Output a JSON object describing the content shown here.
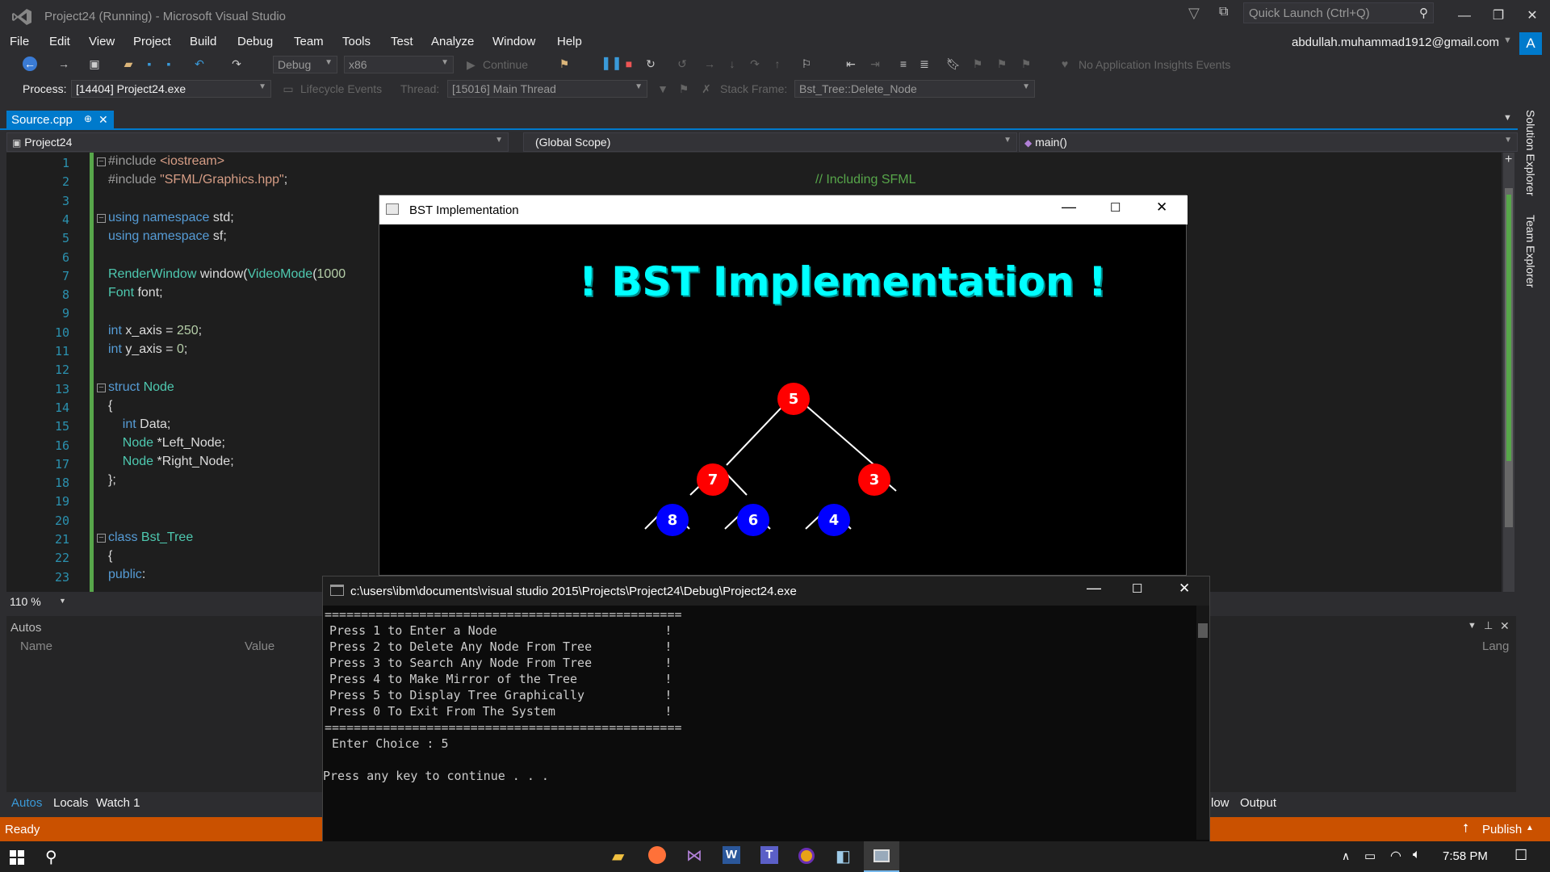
{
  "window": {
    "title": "Project24 (Running) - Microsoft Visual Studio",
    "quick_launch_placeholder": "Quick Launch (Ctrl+Q)",
    "account": "abdullah.muhammad1912@gmail.com",
    "avatar_letter": "A"
  },
  "menu": [
    "File",
    "Edit",
    "View",
    "Project",
    "Build",
    "Debug",
    "Team",
    "Tools",
    "Test",
    "Analyze",
    "Window",
    "Help"
  ],
  "toolbar": {
    "config": "Debug",
    "platform": "x86",
    "continue_label": "Continue",
    "insights": "No Application Insights Events",
    "process_label": "Process:",
    "process_value": "[14404] Project24.exe",
    "lifecycle": "Lifecycle Events",
    "thread_label": "Thread:",
    "thread_value": "[15016] Main Thread",
    "stack_label": "Stack Frame:",
    "stack_value": "Bst_Tree::Delete_Node"
  },
  "editor": {
    "tab": "Source.cpp",
    "project_combo": "Project24",
    "scope_combo": "(Global Scope)",
    "member_combo": "main()",
    "zoom": "110 %",
    "line_numbers": [
      "1",
      "2",
      "3",
      "4",
      "5",
      "6",
      "7",
      "8",
      "9",
      "10",
      "11",
      "12",
      "13",
      "14",
      "15",
      "16",
      "17",
      "18",
      "19",
      "20",
      "21",
      "22",
      "23"
    ],
    "comment": "// Including SFML"
  },
  "autos": {
    "title": "Autos",
    "col_name": "Name",
    "col_value": "Value",
    "col_lang": "Lang"
  },
  "bottom_tabs": {
    "autos": "Autos",
    "locals": "Locals",
    "watch": "Watch 1",
    "flow": "low",
    "output": "Output"
  },
  "status": {
    "ready": "Ready",
    "publish": "Publish"
  },
  "side_panel": {
    "solution": "Solution Explorer",
    "team": "Team Explorer"
  },
  "sfml_window": {
    "title": "BST Implementation",
    "heading": "! BST Implementation !",
    "nodes": [
      {
        "value": "5",
        "color": "#ff0000"
      },
      {
        "value": "7",
        "color": "#ff0000"
      },
      {
        "value": "3",
        "color": "#ff0000"
      },
      {
        "value": "8",
        "color": "#0000ff"
      },
      {
        "value": "6",
        "color": "#0000ff"
      },
      {
        "value": "4",
        "color": "#0000ff"
      }
    ]
  },
  "console": {
    "title": "c:\\users\\ibm\\documents\\visual studio 2015\\Projects\\Project24\\Debug\\Project24.exe",
    "separator": "=================================================",
    "options": [
      "Press 1 to Enter a Node                       !",
      "Press 2 to Delete Any Node From Tree          !",
      "Press 3 to Search Any Node From Tree          !",
      "Press 4 to Make Mirror of the Tree            !",
      "Press 5 to Display Tree Graphically           !",
      "Press 0 To Exit From The System               !"
    ],
    "choice": " Enter Choice : 5",
    "continue": "Press any key to continue . . ."
  },
  "taskbar": {
    "time": "7:58 PM"
  },
  "colors": {
    "accent": "#007acc",
    "status_bar": "#ca5100",
    "heading_cyan": "#00ffff"
  }
}
